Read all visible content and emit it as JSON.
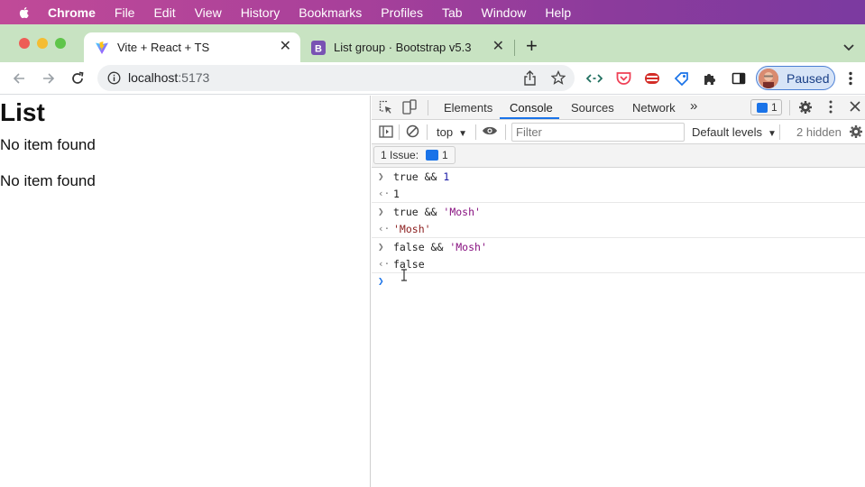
{
  "menubar": {
    "app": "Chrome",
    "items": [
      "File",
      "Edit",
      "View",
      "History",
      "Bookmarks",
      "Profiles",
      "Tab",
      "Window",
      "Help"
    ]
  },
  "tabs": [
    {
      "title": "Vite + React + TS",
      "favicon": "vite-icon",
      "active": true
    },
    {
      "title": "List group · Bootstrap v5.3",
      "favicon": "bootstrap-icon",
      "active": false
    }
  ],
  "toolbar": {
    "url_host": "localhost",
    "url_port": ":5173",
    "profile_label": "Paused"
  },
  "page": {
    "heading": "List",
    "messages": [
      "No item found",
      "No item found"
    ]
  },
  "devtools": {
    "tabs": [
      "Elements",
      "Console",
      "Sources",
      "Network"
    ],
    "active_tab": "Console",
    "more": "»",
    "issues_badge": "1",
    "context": "top",
    "filter_placeholder": "Filter",
    "levels": "Default levels",
    "hidden": "2 hidden",
    "issue_bar": {
      "label": "1 Issue:",
      "count": "1"
    },
    "console": [
      {
        "input_a": "true",
        "op": " && ",
        "input_b": "1",
        "result": "1"
      },
      {
        "input_a": "true",
        "op": " && ",
        "input_b": "'Mosh'",
        "result": "'Mosh'"
      },
      {
        "input_a": "false",
        "op": " && ",
        "input_b": "'Mosh'",
        "result": "false"
      }
    ]
  },
  "colors": {
    "accent": "#1a73e8",
    "tabstrip": "#c8e3c2",
    "menubar": "#a8409a"
  }
}
